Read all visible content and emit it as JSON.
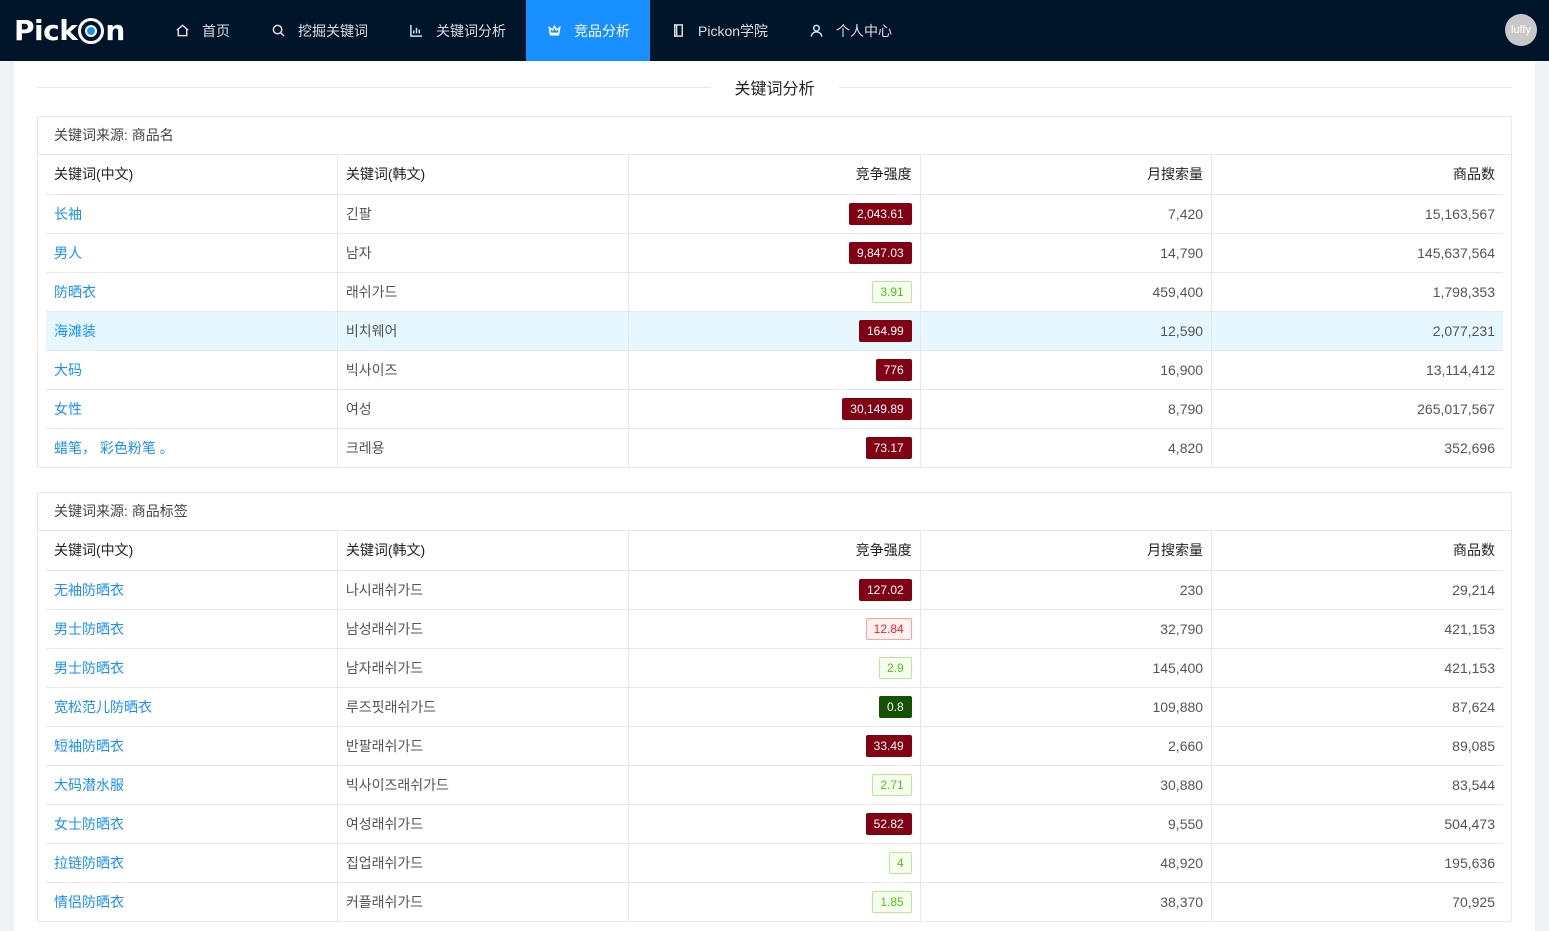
{
  "nav": {
    "logo": "Pick",
    "logo_tail": "n",
    "items": [
      {
        "label": "首页",
        "icon": "home-icon"
      },
      {
        "label": "挖掘关键词",
        "icon": "search-icon"
      },
      {
        "label": "关键词分析",
        "icon": "chart-icon"
      },
      {
        "label": "竞品分析",
        "icon": "crown-icon",
        "active": true
      },
      {
        "label": "Pickon学院",
        "icon": "book-icon"
      },
      {
        "label": "个人中心",
        "icon": "user-icon"
      }
    ],
    "user": "luffy"
  },
  "colors": {
    "nav_bg": "#001529",
    "active": "#1890ff",
    "link": "#1890ff",
    "tag_high": "#820014",
    "tag_best": "#135200"
  },
  "page_title": "关键词分析",
  "columns": [
    "关键词(中文)",
    "关键词(韩文)",
    "竞争强度",
    "月搜索量",
    "商品数"
  ],
  "sections": [
    {
      "title": "关键词来源: 商品名",
      "rows": [
        {
          "zh": "长袖",
          "ko": "긴팔",
          "comp": "2,043.61",
          "level": "high",
          "search": "7,420",
          "goods": "15,163,567"
        },
        {
          "zh": "男人",
          "ko": "남자",
          "comp": "9,847.03",
          "level": "high",
          "search": "14,790",
          "goods": "145,637,564"
        },
        {
          "zh": "防晒衣",
          "ko": "래쉬가드",
          "comp": "3.91",
          "level": "low",
          "search": "459,400",
          "goods": "1,798,353"
        },
        {
          "zh": "海滩装",
          "ko": "비치웨어",
          "comp": "164.99",
          "level": "high",
          "search": "12,590",
          "goods": "2,077,231",
          "highlight": true
        },
        {
          "zh": "大码",
          "ko": "빅사이즈",
          "comp": "776",
          "level": "high",
          "search": "16,900",
          "goods": "13,114,412"
        },
        {
          "zh": "女性",
          "ko": "여성",
          "comp": "30,149.89",
          "level": "high",
          "search": "8,790",
          "goods": "265,017,567"
        },
        {
          "zh": "蜡笔， 彩色粉笔 。",
          "ko": "크레용",
          "comp": "73.17",
          "level": "high",
          "search": "4,820",
          "goods": "352,696"
        }
      ]
    },
    {
      "title": "关键词来源: 商品标签",
      "rows": [
        {
          "zh": "无袖防晒衣",
          "ko": "나시래쉬가드",
          "comp": "127.02",
          "level": "high",
          "search": "230",
          "goods": "29,214"
        },
        {
          "zh": "男士防晒衣",
          "ko": "남성래쉬가드",
          "comp": "12.84",
          "level": "mid",
          "search": "32,790",
          "goods": "421,153"
        },
        {
          "zh": "男士防晒衣",
          "ko": "남자래쉬가드",
          "comp": "2.9",
          "level": "low",
          "search": "145,400",
          "goods": "421,153"
        },
        {
          "zh": "宽松范儿防晒衣",
          "ko": "루즈핏래쉬가드",
          "comp": "0.8",
          "level": "best",
          "search": "109,880",
          "goods": "87,624"
        },
        {
          "zh": "短袖防晒衣",
          "ko": "반팔래쉬가드",
          "comp": "33.49",
          "level": "high",
          "search": "2,660",
          "goods": "89,085"
        },
        {
          "zh": "大码潜水服",
          "ko": "빅사이즈래쉬가드",
          "comp": "2.71",
          "level": "low",
          "search": "30,880",
          "goods": "83,544"
        },
        {
          "zh": "女士防晒衣",
          "ko": "여성래쉬가드",
          "comp": "52.82",
          "level": "high",
          "search": "9,550",
          "goods": "504,473"
        },
        {
          "zh": "拉链防晒衣",
          "ko": "집업래쉬가드",
          "comp": "4",
          "level": "low",
          "search": "48,920",
          "goods": "195,636"
        },
        {
          "zh": "情侣防晒衣",
          "ko": "커플래쉬가드",
          "comp": "1.85",
          "level": "low",
          "search": "38,370",
          "goods": "70,925"
        }
      ]
    }
  ]
}
